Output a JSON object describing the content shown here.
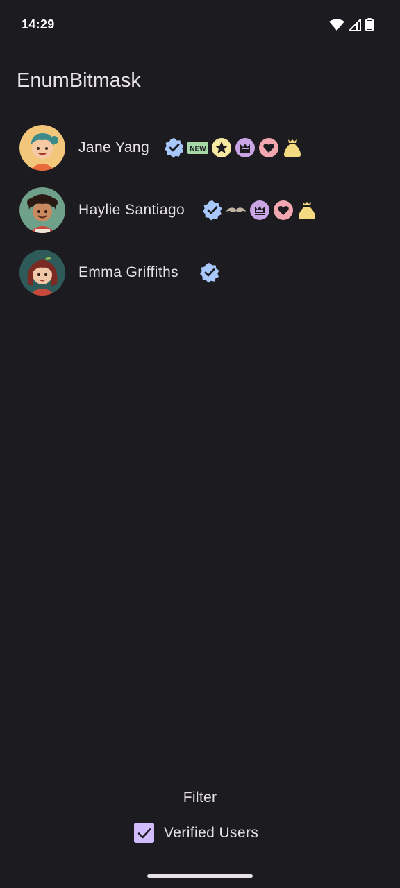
{
  "status_bar": {
    "time": "14:29"
  },
  "app": {
    "title": "EnumBitmask"
  },
  "users": [
    {
      "name": "Jane Yang",
      "badges": [
        "verified-icon",
        "new-icon",
        "star-icon",
        "crown-icon",
        "heart-icon",
        "money-bag-icon"
      ],
      "new_label": "NEW"
    },
    {
      "name": "Haylie Santiago",
      "badges": [
        "verified-icon",
        "mustache-icon",
        "crown-icon",
        "heart-icon",
        "money-bag-icon"
      ]
    },
    {
      "name": "Emma Griffiths",
      "badges": [
        "verified-icon"
      ]
    }
  ],
  "filter": {
    "title": "Filter",
    "verified_label": "Verified Users",
    "verified_checked": true
  },
  "colors": {
    "background": "#1c1b20",
    "verified": "#a8c7fa",
    "new": "#a6d8a8",
    "star": "#f7e9a0",
    "crown": "#c9a5e6",
    "heart": "#f2a7b0",
    "mustache": "#c2b2a2",
    "money": "#f4da80",
    "checkbox": "#d0bcff"
  }
}
